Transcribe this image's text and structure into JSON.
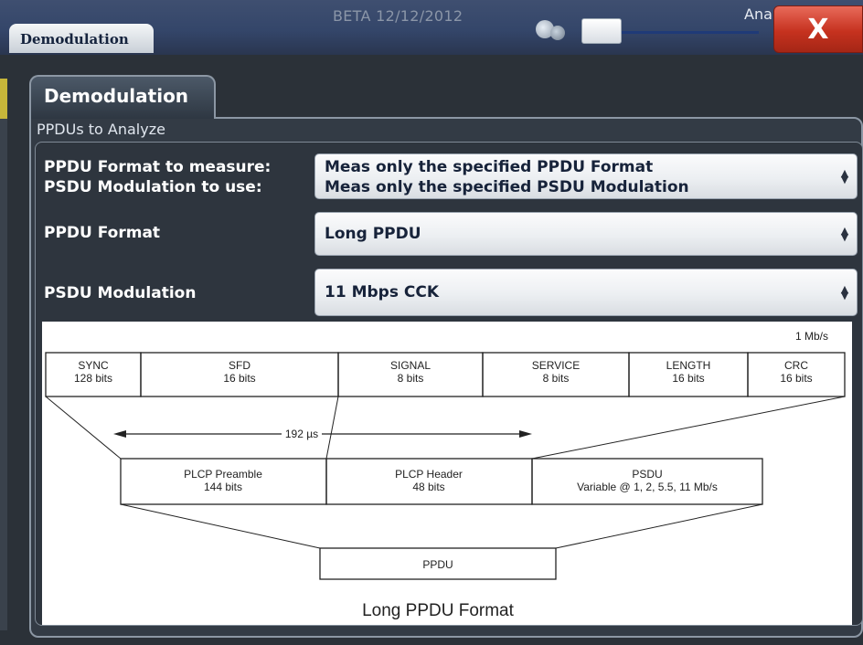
{
  "window": {
    "title": "Demodulation",
    "beta_text": "BETA 12/12/2012",
    "partial_label": "Ana",
    "close_label": "X"
  },
  "dialog": {
    "tab_label": "Demodulation",
    "section_label": "PPDUs to Analyze",
    "rows": {
      "format_to_measure_label": "PPDU Format to measure:",
      "modulation_to_use_label": "PSDU Modulation to use:",
      "format_to_measure_value": "Meas only the specified PPDU Format",
      "modulation_to_use_value": "Meas only the specified PSDU Modulation",
      "ppdu_format_label": "PPDU Format",
      "ppdu_format_value": "Long PPDU",
      "psdu_modulation_label": "PSDU Modulation",
      "psdu_modulation_value": "11 Mbps CCK"
    }
  },
  "diagram": {
    "rate": "1 Mb/s",
    "fields": [
      {
        "name": "SYNC",
        "bits": "128 bits"
      },
      {
        "name": "SFD",
        "bits": "16 bits"
      },
      {
        "name": "SIGNAL",
        "bits": "8 bits"
      },
      {
        "name": "SERVICE",
        "bits": "8 bits"
      },
      {
        "name": "LENGTH",
        "bits": "16 bits"
      },
      {
        "name": "CRC",
        "bits": "16 bits"
      }
    ],
    "duration": "192 µs",
    "middle": [
      {
        "name": "PLCP Preamble",
        "sub": "144 bits"
      },
      {
        "name": "PLCP Header",
        "sub": "48 bits"
      },
      {
        "name": "PSDU",
        "sub": "Variable @ 1, 2, 5.5, 11 Mb/s"
      }
    ],
    "ppdu": "PPDU",
    "caption": "Long PPDU Format"
  },
  "colors": {
    "background": "#2b3138",
    "close_button": "#c6321f",
    "titlebar": "#34466a"
  },
  "icons": {
    "close": "close-icon",
    "select_arrows": "updown-chevron-icon"
  }
}
